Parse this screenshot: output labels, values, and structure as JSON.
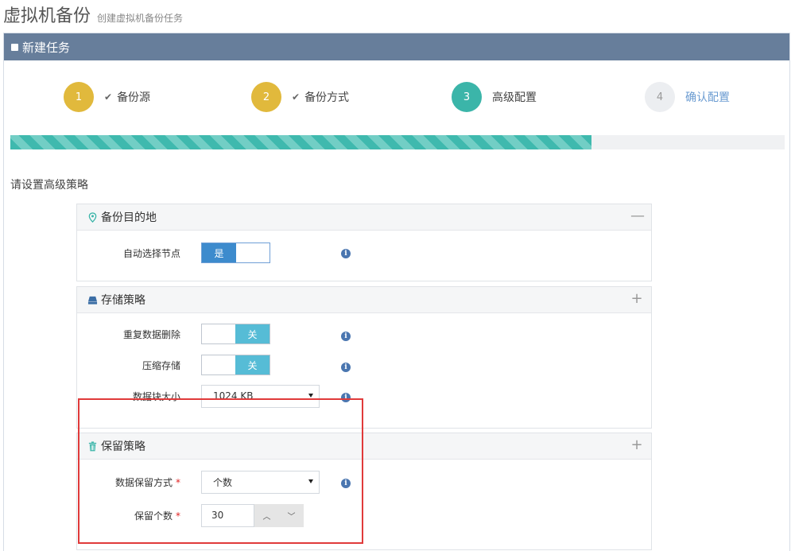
{
  "header": {
    "title": "虚拟机备份",
    "subtitle": "创建虚拟机备份任务"
  },
  "portlet": {
    "title": "新建任务"
  },
  "steps": [
    {
      "number": "1",
      "check": "✔",
      "label": "备份源",
      "color": "#e1b93c"
    },
    {
      "number": "2",
      "check": "✔",
      "label": "备份方式",
      "color": "#e1b93c"
    },
    {
      "number": "3",
      "check": "",
      "label": "高级配置",
      "color": "#3bb5a9"
    },
    {
      "number": "4",
      "check": "",
      "label": "确认配置",
      "color": "#eceef1"
    }
  ],
  "progress": {
    "percent": 75
  },
  "section_label": "请设置高级策略",
  "panels": {
    "destination": {
      "title": "备份目的地",
      "tool": "—",
      "fields": {
        "auto_node": {
          "label": "自动选择节点",
          "value": "是"
        }
      }
    },
    "storage": {
      "title": "存储策略",
      "tool": "+",
      "fields": {
        "dedup": {
          "label": "重复数据删除",
          "value": "关"
        },
        "compress": {
          "label": "压缩存储",
          "value": "关"
        },
        "block_size": {
          "label": "数据块大小",
          "value": "1024 KB"
        }
      }
    },
    "retention": {
      "title": "保留策略",
      "tool": "+",
      "fields": {
        "mode": {
          "label": "数据保留方式",
          "value": "个数",
          "required": "*"
        },
        "count": {
          "label": "保留个数",
          "value": "30",
          "required": "*"
        }
      }
    }
  },
  "info_glyph": "i",
  "spinner": {
    "up": "︿",
    "down": "﹀"
  },
  "colors": {
    "accent_teal": "#3bb5a9",
    "step_done": "#e1b93c",
    "header_bar": "#677e9b",
    "switch_on": "#3d8bcd",
    "switch_off": "#56bcd6",
    "highlight": "#e03a3a"
  }
}
